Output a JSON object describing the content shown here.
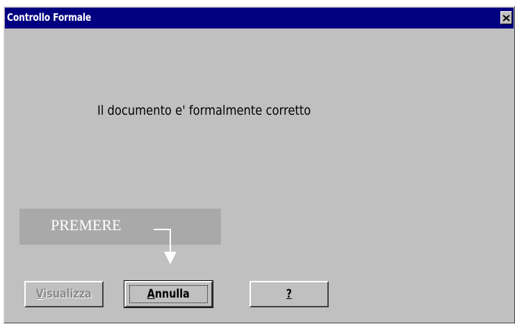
{
  "window": {
    "title": "Controllo Formale",
    "close_glyph": "✕"
  },
  "message": "Il documento e' formalmente corretto",
  "hint": {
    "text": "PREMERE",
    "icon": "arrow-down-icon"
  },
  "buttons": {
    "visualizza": {
      "mnemonic": "V",
      "rest": "isualizza",
      "enabled": false
    },
    "annulla": {
      "mnemonic": "A",
      "rest": "nnulla",
      "enabled": true,
      "focused": true
    },
    "help": {
      "mnemonic": "?",
      "rest": "",
      "enabled": true
    }
  },
  "colors": {
    "titlebar": "#000080",
    "dialog_bg": "#c0c0c0",
    "hint_bg": "#a9a9a9",
    "disabled_text": "#8a8a8a"
  }
}
